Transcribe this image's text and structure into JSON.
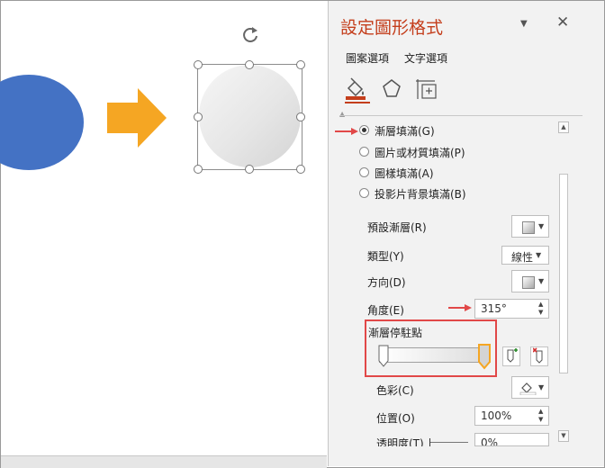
{
  "pane": {
    "title": "設定圖形格式",
    "tabs": [
      "圖案選項",
      "文字選項"
    ],
    "icons": [
      "fill-line-icon",
      "effects-pentagon-icon",
      "size-properties-icon"
    ]
  },
  "fill_options": [
    {
      "label": "漸層填滿(G)",
      "selected": true
    },
    {
      "label": "圖片或材質填滿(P)",
      "selected": false
    },
    {
      "label": "圖樣填滿(A)",
      "selected": false
    },
    {
      "label": "投影片背景填滿(B)",
      "selected": false
    }
  ],
  "props": {
    "preset_label": "預設漸層(R)",
    "type_label": "類型(Y)",
    "type_value": "線性",
    "direction_label": "方向(D)",
    "angle_label": "角度(E)",
    "angle_value": "315°",
    "stops_label": "漸層停駐點",
    "color_label": "色彩(C)",
    "position_label": "位置(O)",
    "position_value": "100%",
    "transparency_label": "透明度(T)",
    "transparency_value": "0%"
  },
  "colors": {
    "accent": "#c43e1c",
    "highlight": "#e14848",
    "circle_blue": "#4472c4",
    "arrow_orange": "#f5a623"
  }
}
